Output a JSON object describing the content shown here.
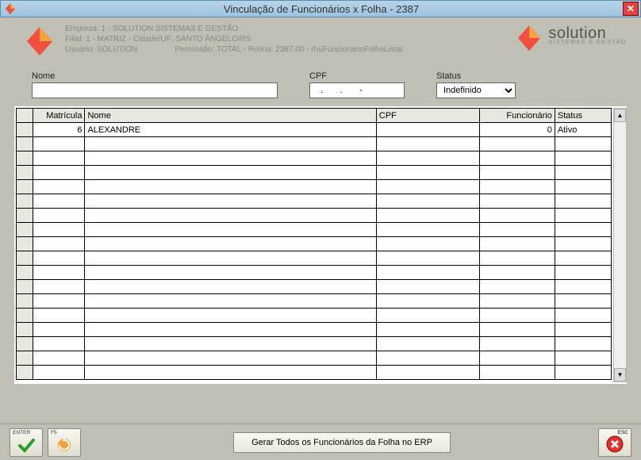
{
  "titlebar": {
    "title": "Vinculação de Funcionários x Folha -  2387"
  },
  "header": {
    "empresa": "Empresa: 1 - SOLUTION SISTEMAS E GESTÃO",
    "filial": "Filial: 1 - MATRIZ - Cidade/UF: SANTO ÂNGELO/RS",
    "usuario": "Usuário: SOLUTION",
    "permissao": "Permissão: TOTAL - Rotina: 2387.00 - rhuFuncionarioFolhaListar",
    "brand_name": "solution",
    "brand_tag": "SISTEMAS E GESTÃO"
  },
  "filters": {
    "nome_label": "Nome",
    "nome_value": "",
    "cpf_label": "CPF",
    "cpf_value": "   .       .       -",
    "status_label": "Status",
    "status_value": "Indefinido"
  },
  "grid": {
    "columns": {
      "matricula": "Matrícula",
      "nome": "Nome",
      "cpf": "CPF",
      "funcionario": "Funcionário",
      "status": "Status"
    },
    "rows": [
      {
        "matricula": "6",
        "nome": "ALEXANDRE",
        "cpf": "",
        "funcionario": "0",
        "status": "Ativo"
      }
    ],
    "empty_row_count": 17
  },
  "footer": {
    "enter_key": "ENTER",
    "f5_key": "F5",
    "gen_label": "Gerar Todos os Funcionários da Folha no ERP",
    "esc_key": "ESC"
  },
  "colors": {
    "accent": "#f04e3e",
    "accent2": "#f7a13d"
  }
}
